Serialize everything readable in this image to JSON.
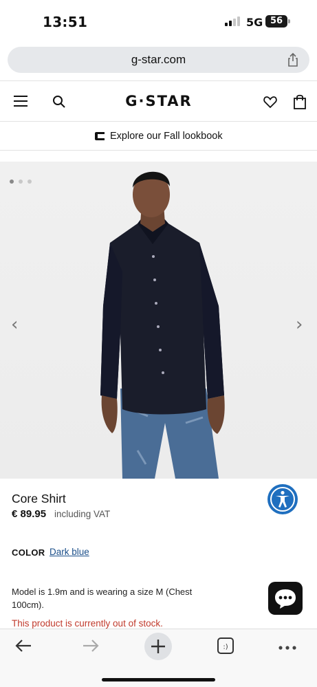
{
  "status_bar": {
    "time": "13:51",
    "network": "5G",
    "battery": "56"
  },
  "browser": {
    "url": "g-star.com"
  },
  "header": {
    "logo": "G·STAR",
    "icons": [
      "menu-icon",
      "search-icon",
      "heart-icon",
      "bag-icon"
    ]
  },
  "promo": {
    "text": "Explore our Fall lookbook"
  },
  "gallery": {
    "slide_count": 3,
    "active_slide": 1,
    "prev_arrow": "‹",
    "next_arrow": "›"
  },
  "product": {
    "title": "Core Shirt",
    "price": "€ 89.95",
    "vat_note": "including VAT",
    "color_label": "COLOR",
    "color_value": "Dark blue",
    "model_info": "Model is 1.9m and is wearing a size M (Chest 100cm).",
    "stock_message": "This product is currently out of stock."
  },
  "colors": {
    "accessibility_blue": "#1f6fbf",
    "link_blue": "#1b4f8a",
    "error_red": "#c0392b",
    "shirt_navy": "#1a1d2b"
  }
}
